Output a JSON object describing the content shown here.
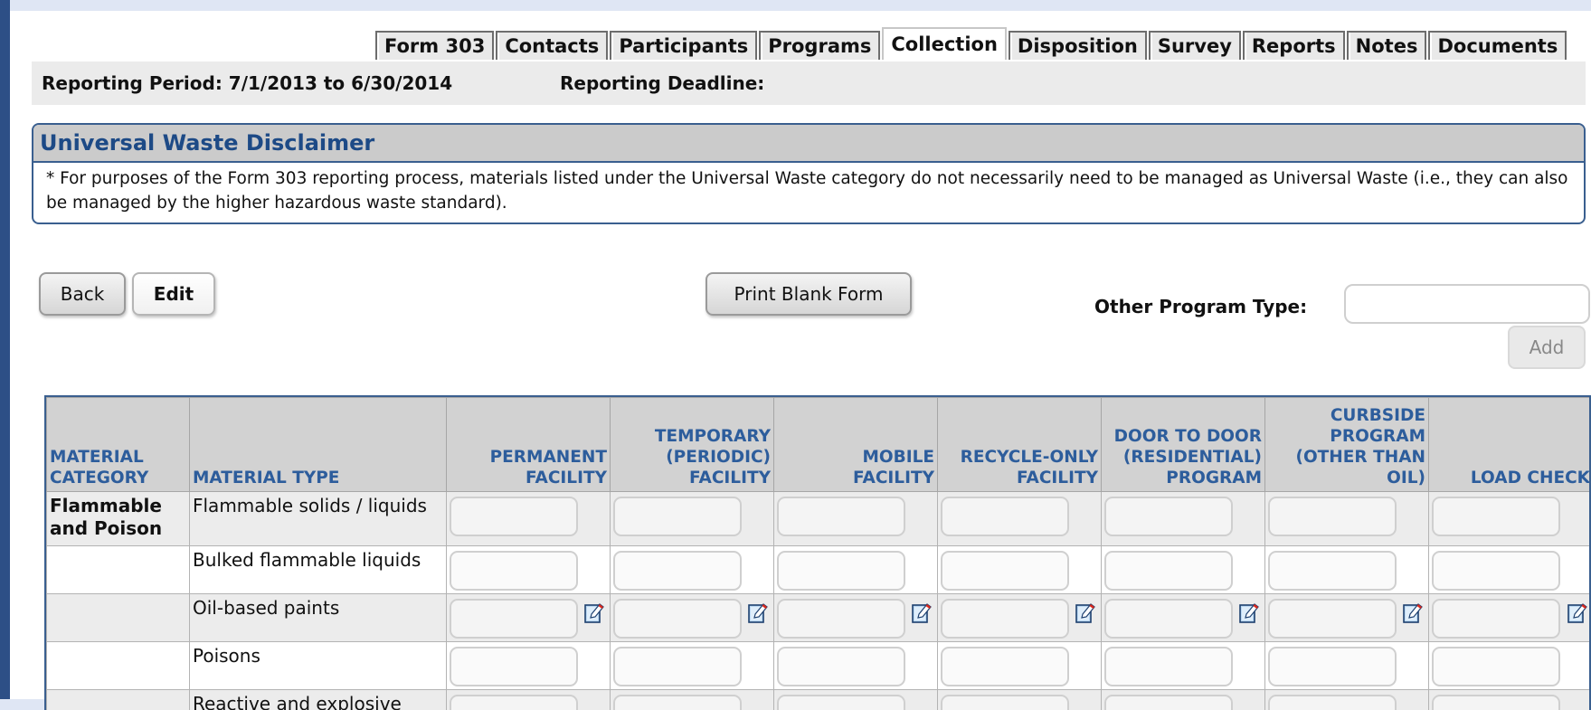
{
  "tabs": [
    {
      "label": "Form 303",
      "active": false
    },
    {
      "label": "Contacts",
      "active": false
    },
    {
      "label": "Participants",
      "active": false
    },
    {
      "label": "Programs",
      "active": false
    },
    {
      "label": "Collection",
      "active": true
    },
    {
      "label": "Disposition",
      "active": false
    },
    {
      "label": "Survey",
      "active": false
    },
    {
      "label": "Reports",
      "active": false
    },
    {
      "label": "Notes",
      "active": false
    },
    {
      "label": "Documents",
      "active": false
    }
  ],
  "period": {
    "reporting_period": "Reporting Period: 7/1/2013 to 6/30/2014",
    "reporting_deadline": "Reporting Deadline:"
  },
  "disclaimer": {
    "title": "Universal Waste Disclaimer",
    "text": "* For purposes of the Form 303 reporting process, materials listed under the Universal Waste category do not necessarily need to be managed as Universal Waste (i.e., they can also be managed by the higher hazardous waste standard)."
  },
  "buttons": {
    "back": "Back",
    "edit": "Edit",
    "print": "Print Blank Form",
    "add": "Add"
  },
  "other_program": {
    "label": "Other Program Type:",
    "value": ""
  },
  "table": {
    "headers": {
      "category": "MATERIAL CATEGORY",
      "type": "MATERIAL TYPE",
      "permanent": "PERMANENT FACILITY",
      "temporary": "TEMPORARY (PERIODIC) FACILITY",
      "mobile": "MOBILE FACILITY",
      "recycle": "RECYCLE-ONLY FACILITY",
      "door": "DOOR TO DOOR (RESIDENTIAL) PROGRAM",
      "curbside": "CURBSIDE PROGRAM (OTHER THAN OIL)",
      "load": "LOAD CHECK"
    },
    "rows": [
      {
        "category": "Flammable and Poison",
        "type": "Flammable solids / liquids",
        "style": "alt",
        "notes": false
      },
      {
        "category": "",
        "type": "Bulked flammable liquids",
        "style": "plain",
        "notes": false
      },
      {
        "category": "",
        "type": "Oil-based paints",
        "style": "alt",
        "notes": true
      },
      {
        "category": "",
        "type": "Poisons",
        "style": "plain",
        "notes": false
      },
      {
        "category": "",
        "type": "Reactive and explosive",
        "style": "alt",
        "notes": false
      }
    ]
  },
  "colors": {
    "frame_blue": "#2d4f86",
    "header_blue": "#2d5d9c",
    "border_blue": "#3a5f8f"
  }
}
